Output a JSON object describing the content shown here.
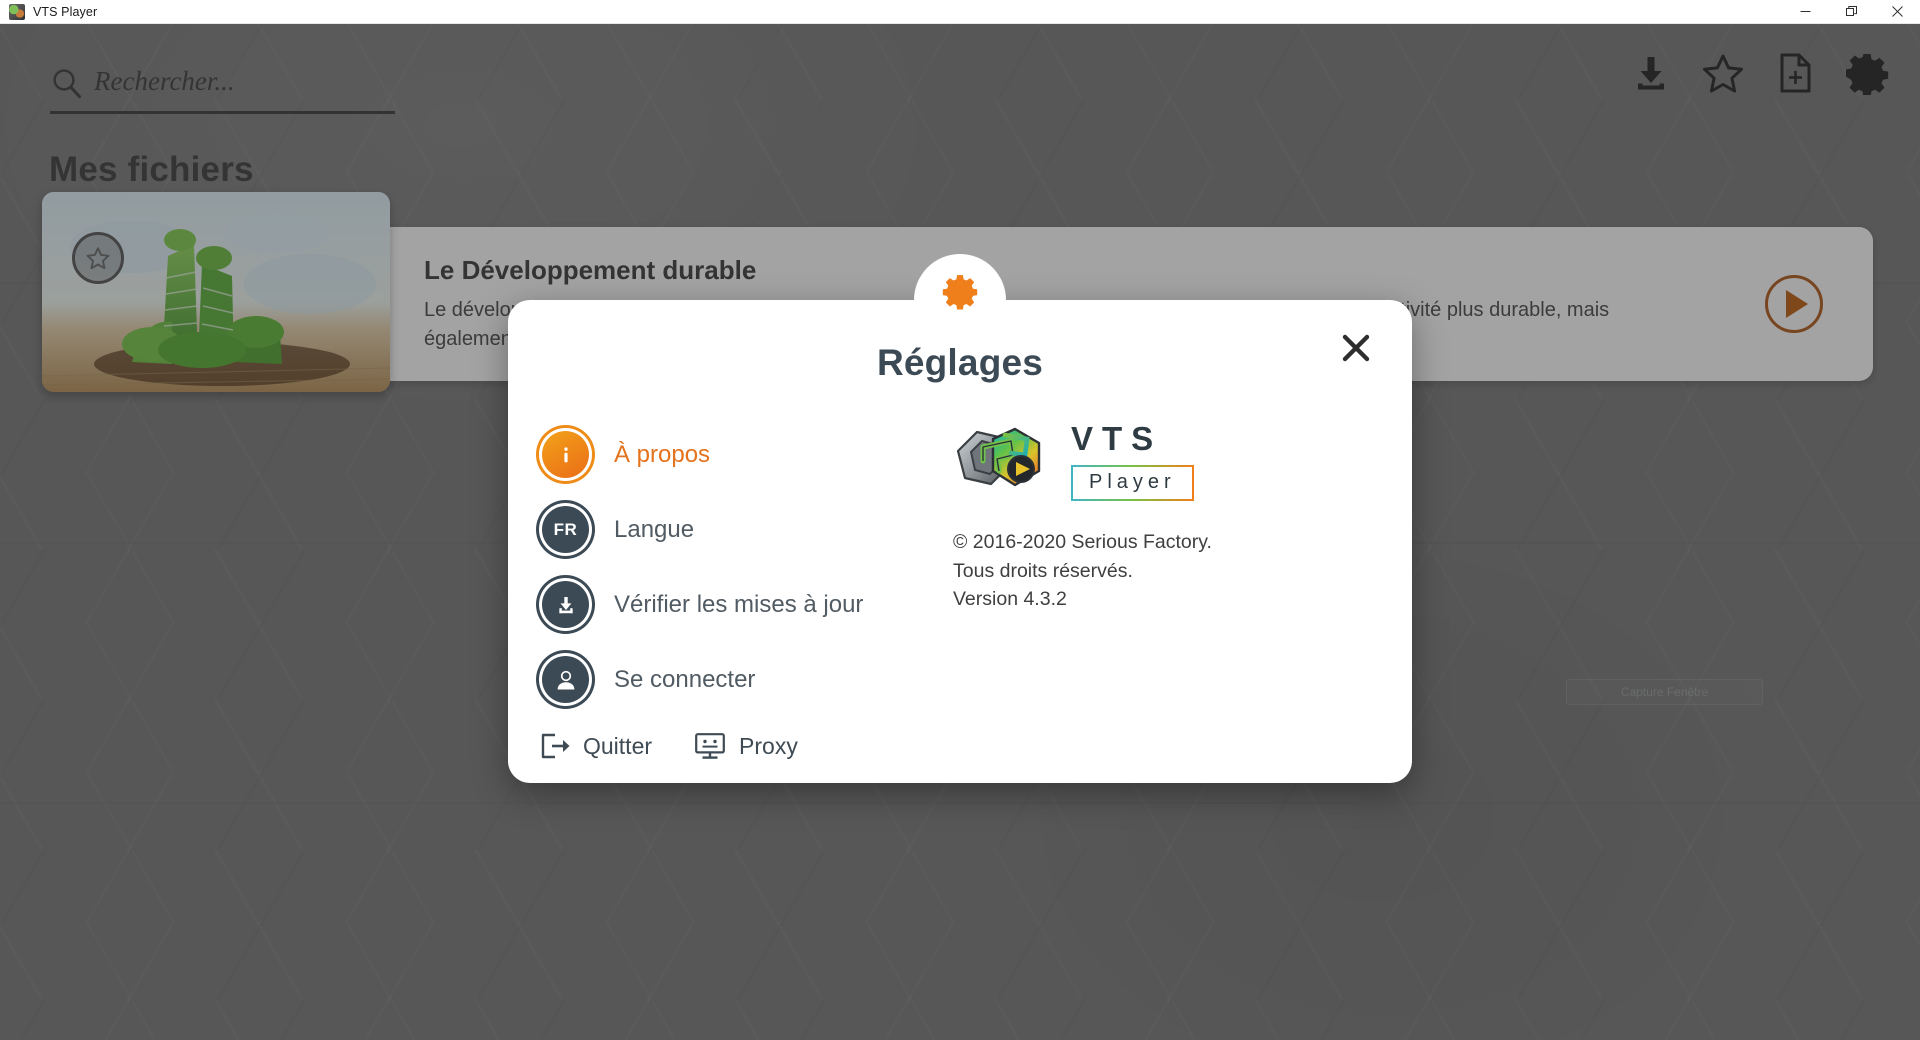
{
  "window": {
    "title": "VTS Player",
    "app_icon": "vts-app-icon",
    "controls": [
      {
        "name": "minimize",
        "glyph": "minimize-icon"
      },
      {
        "name": "maximize",
        "glyph": "maximize-icon"
      },
      {
        "name": "close",
        "glyph": "close-icon"
      }
    ]
  },
  "search": {
    "placeholder": "Rechercher...",
    "value": "",
    "icon": "search-icon"
  },
  "toolbar": {
    "items": [
      {
        "name": "download-icon",
        "label": "Télécharger"
      },
      {
        "name": "star-icon",
        "label": "Favoris"
      },
      {
        "name": "file-plus-icon",
        "label": "Ajouter un fichier"
      },
      {
        "name": "gear-icon",
        "label": "Réglages"
      }
    ]
  },
  "main": {
    "page_title": "Mes fichiers",
    "card": {
      "title": "Le Développement durable",
      "description": "Le développement durable est dans tous les esprits du 21e siècle. Chaque entreprise se doit de rendre son activité plus durable, mais également à sensibiliser ses collaborateurs.",
      "favorite_icon": "star-outline-icon",
      "play_icon": "play-icon",
      "thumbnail": "green-building-illustration"
    },
    "capture_widget": {
      "label": "Capture Fenêtre"
    }
  },
  "modal": {
    "badge_icon": "gear-icon",
    "title": "Réglages",
    "close_icon": "close-icon",
    "menu": [
      {
        "id": "about",
        "icon": "info-icon",
        "badge": "i",
        "label": "À propos",
        "active": true
      },
      {
        "id": "language",
        "icon": "language-icon",
        "badge": "FR",
        "label": "Langue",
        "active": false
      },
      {
        "id": "updates",
        "icon": "download-icon",
        "badge": "",
        "label": "Vérifier les mises à jour",
        "active": false
      },
      {
        "id": "login",
        "icon": "user-icon",
        "badge": "",
        "label": "Se connecter",
        "active": false
      }
    ],
    "bottom_actions": [
      {
        "id": "quit",
        "icon": "exit-icon",
        "label": "Quitter"
      },
      {
        "id": "proxy",
        "icon": "monitor-icon",
        "label": "Proxy"
      }
    ],
    "about": {
      "logo_name": "vts-player-logo",
      "logo_primary": "VTS",
      "logo_secondary": "Player",
      "copyright_line1": "© 2016-2020 Serious Factory.",
      "copyright_line2": "Tous droits réservés.",
      "version_line": "Version 4.3.2"
    }
  },
  "colors": {
    "accent_orange": "#e5721c",
    "dark_slate": "#3c4a55",
    "app_background": "#757575",
    "modal_background": "#ffffff"
  }
}
